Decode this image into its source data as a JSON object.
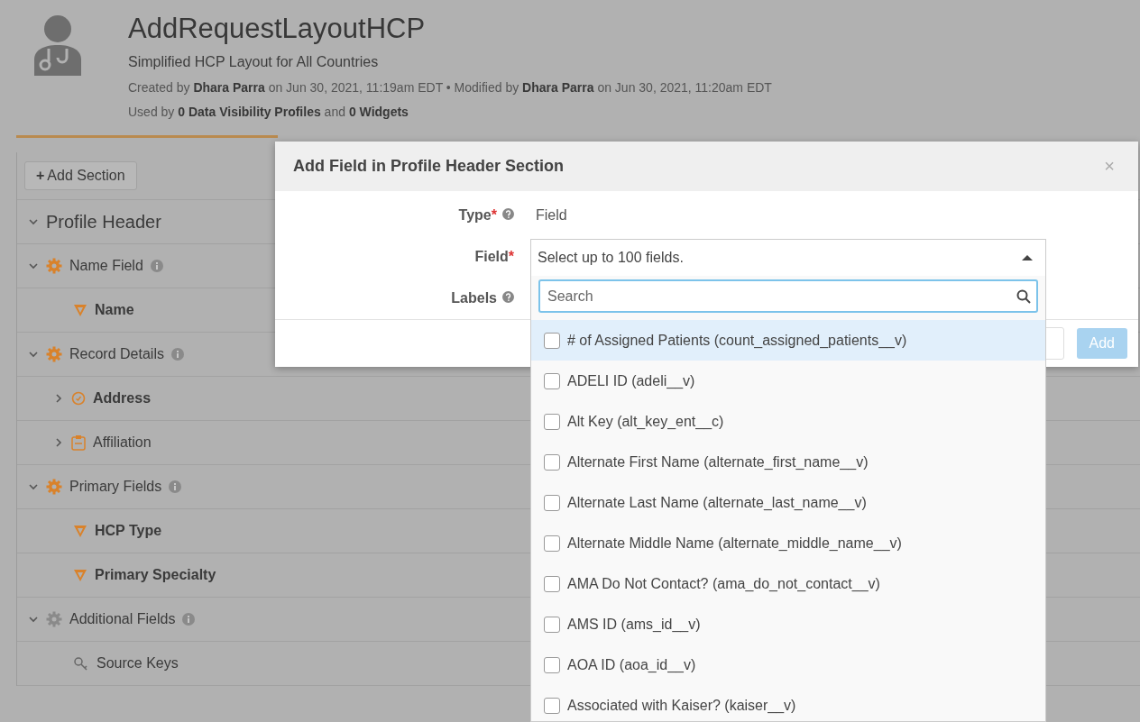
{
  "header": {
    "title": "AddRequestLayoutHCP",
    "subtitle": "Simplified HCP Layout for All Countries",
    "meta": "Created by **Dhara Parra** on Jun 30, 2021, 11:19am EDT • Modified by **Dhara Parra** on Jun 30, 2021, 11:20am EDT",
    "usage": "Used by **0 Data Visibility Profiles** and **0 Widgets**"
  },
  "add_section_button": {
    "icon": "+",
    "label": "Add Section"
  },
  "tree": [
    {
      "kind": "section",
      "label": "Profile Header",
      "expanded": true,
      "children": [
        {
          "kind": "group",
          "label": "Name Field",
          "expanded": true,
          "color": "#d9822b",
          "children": [
            {
              "kind": "field",
              "label": "Name",
              "bold": true
            }
          ]
        },
        {
          "kind": "group",
          "label": "Record Details",
          "expanded": true,
          "color": "#d9822b",
          "children": [
            {
              "kind": "object",
              "label": "Address",
              "expanded": false,
              "bold": true
            },
            {
              "kind": "relation",
              "label": "Affiliation",
              "expanded": false,
              "bold": false
            }
          ]
        },
        {
          "kind": "group",
          "label": "Primary Fields",
          "expanded": true,
          "color": "#d9822b",
          "children": [
            {
              "kind": "field",
              "label": "HCP Type",
              "bold": true
            },
            {
              "kind": "field",
              "label": "Primary Specialty",
              "bold": true
            }
          ]
        },
        {
          "kind": "group",
          "label": "Additional Fields",
          "expanded": true,
          "color": "#8a8a8a",
          "children": [
            {
              "kind": "key",
              "label": "Source Keys",
              "bold": false
            }
          ]
        }
      ]
    }
  ],
  "modal": {
    "title": "Add Field in Profile Header Section",
    "close": "×",
    "form": [
      {
        "label": "Type",
        "required": true,
        "help": true,
        "value": "Field"
      },
      {
        "label": "Field",
        "required": true,
        "help": false
      },
      {
        "label": "Labels",
        "required": false,
        "help": true
      }
    ],
    "required_mark": "*",
    "add_button": "Add",
    "select": {
      "placeholder": "Select up to 100 fields.",
      "expanded": true,
      "search_placeholder": "Search",
      "options": [
        {
          "label": "# of Assigned Patients (count_assigned_patients__v)",
          "checked": false,
          "selected": true
        },
        {
          "label": "ADELI ID (adeli__v)",
          "checked": false,
          "selected": false
        },
        {
          "label": "Alt Key (alt_key_ent__c)",
          "checked": false,
          "selected": false
        },
        {
          "label": "Alternate First Name (alternate_first_name__v)",
          "checked": false,
          "selected": false
        },
        {
          "label": "Alternate Last Name (alternate_last_name__v)",
          "checked": false,
          "selected": false
        },
        {
          "label": "Alternate Middle Name (alternate_middle_name__v)",
          "checked": false,
          "selected": false
        },
        {
          "label": "AMA Do Not Contact? (ama_do_not_contact__v)",
          "checked": false,
          "selected": false
        },
        {
          "label": "AMS ID (ams_id__v)",
          "checked": false,
          "selected": false
        },
        {
          "label": "AOA ID (aoa_id__v)",
          "checked": false,
          "selected": false
        },
        {
          "label": "Associated with Kaiser? (kaiser__v)",
          "checked": false,
          "selected": false
        }
      ]
    }
  }
}
